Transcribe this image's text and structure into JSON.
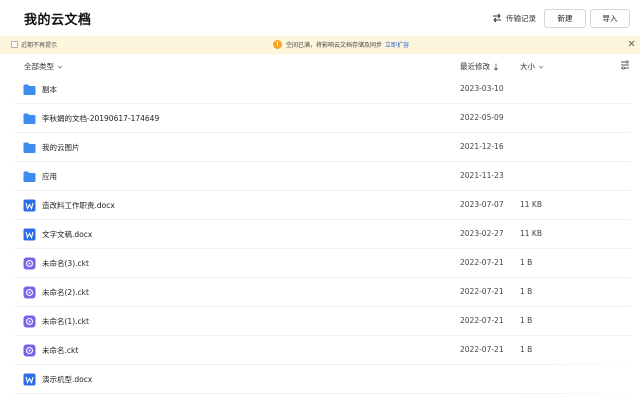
{
  "header": {
    "title": "我的云文档",
    "transfer_label": "传输记录",
    "new_label": "新建",
    "import_label": "导入"
  },
  "notice": {
    "checkbox_label": "近期不再提示",
    "message": "空间已满，将影响云文档存储及同步",
    "link_label": "立即扩容"
  },
  "columns": {
    "type": "全部类型",
    "modified": "最近修改",
    "size": "大小"
  },
  "files": [
    {
      "name": "副本",
      "type": "folder",
      "date": "2023-03-10",
      "size": ""
    },
    {
      "name": "李秋娟的文档-20190617-174649",
      "type": "folder",
      "date": "2022-05-09",
      "size": ""
    },
    {
      "name": "我的云图片",
      "type": "folder",
      "date": "2021-12-16",
      "size": ""
    },
    {
      "name": "应用",
      "type": "folder",
      "date": "2021-11-23",
      "size": ""
    },
    {
      "name": "造改料工作职责.docx",
      "type": "word",
      "date": "2023-07-07",
      "size": "11 KB"
    },
    {
      "name": "文字文稿.docx",
      "type": "word",
      "date": "2023-02-27",
      "size": "11 KB"
    },
    {
      "name": "未命名(3).ckt",
      "type": "ckt",
      "date": "2022-07-21",
      "size": "1 B"
    },
    {
      "name": "未命名(2).ckt",
      "type": "ckt",
      "date": "2022-07-21",
      "size": "1 B"
    },
    {
      "name": "未命名(1).ckt",
      "type": "ckt",
      "date": "2022-07-21",
      "size": "1 B"
    },
    {
      "name": "未命名.ckt",
      "type": "ckt",
      "date": "2022-07-21",
      "size": "1 B"
    },
    {
      "name": "演示机型.docx",
      "type": "word",
      "date": "",
      "size": ""
    }
  ],
  "colors": {
    "folder": "#3f8cf0",
    "word": "#2e6be6",
    "ckt": "#7b62e8",
    "notice_bg": "#fdf6dd",
    "link": "#2f6bd8"
  }
}
